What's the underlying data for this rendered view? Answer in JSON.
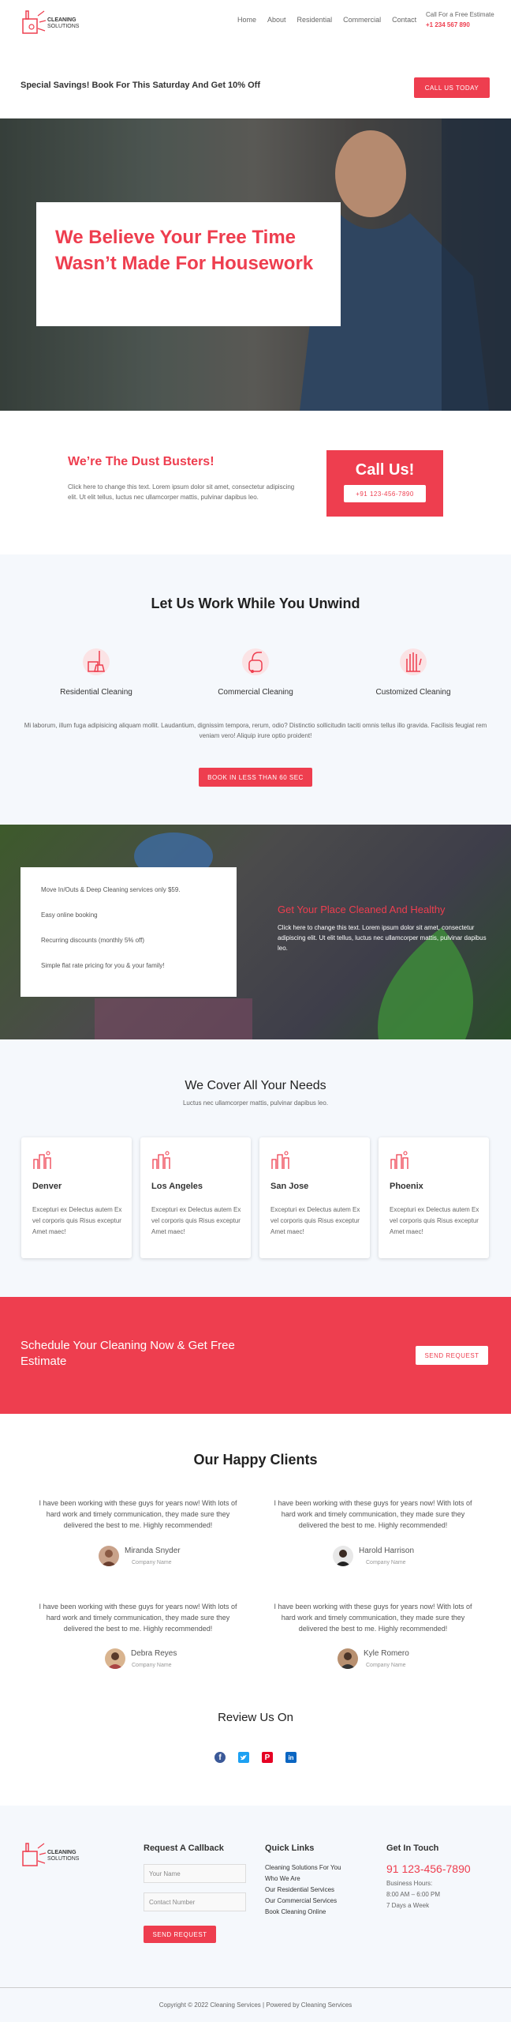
{
  "brand": {
    "line1": "CLEANING",
    "line2": "SOLUTIONS"
  },
  "nav": {
    "items": [
      "Home",
      "About",
      "Residential",
      "Commercial",
      "Contact"
    ],
    "call_label": "Call For a Free Estimate",
    "phone": "+1 234 567 890"
  },
  "promo": {
    "text": "Special Savings! Book For This Saturday And Get 10% Off",
    "button": "CALL US TODAY"
  },
  "hero": {
    "title": "We Believe Your Free Time Wasn’t Made For Housework"
  },
  "dust": {
    "title": "We’re The Dust Busters!",
    "text": "Click here to change this text. Lorem ipsum dolor sit amet, consectetur adipiscing elit. Ut elit tellus, luctus nec ullamcorper mattis, pulvinar dapibus leo.",
    "call_title": "Call Us!",
    "call_phone": "+91 123-456-7890"
  },
  "unwind": {
    "title": "Let Us Work While You Unwind",
    "services": [
      "Residential Cleaning",
      "Commercial Cleaning",
      "Customized Cleaning"
    ],
    "text": "Mi laborum, illum fuga adipisicing aliquam mollit. Laudantium, dignissim tempora, rerum, odio? Distinctio sollicitudin taciti omnis tellus illo gravida. Facilisis feugiat rem veniam vero! Aliquip irure optio proident!",
    "button": "BOOK IN LESS THAN 60 SEC"
  },
  "offers": {
    "items": [
      "Move In/Outs & Deep Cleaning services only $59.",
      "Easy online booking",
      "Recurring discounts (monthly 5% off)",
      "Simple flat rate pricing for you & your family!"
    ],
    "title": "Get Your Place Cleaned And Healthy",
    "text": "Click here to change this text. Lorem ipsum dolor sit amet, consectetur adipiscing elit. Ut elit tellus, luctus nec ullamcorper mattis, pulvinar dapibus leo."
  },
  "cover": {
    "title": "We Cover All Your Needs",
    "subtitle": "Luctus nec ullamcorper mattis, pulvinar dapibus leo.",
    "cities": [
      {
        "name": "Denver",
        "text": "Excepturi ex Delectus autem Ex vel corporis quis Risus exceptur Amet maec!"
      },
      {
        "name": "Los Angeles",
        "text": "Excepturi ex Delectus autem Ex vel corporis quis Risus exceptur Amet maec!"
      },
      {
        "name": "San Jose",
        "text": "Excepturi ex Delectus autem Ex vel corporis quis Risus exceptur Amet maec!"
      },
      {
        "name": "Phoenix",
        "text": "Excepturi ex Delectus autem Ex vel corporis quis Risus exceptur Amet maec!"
      }
    ]
  },
  "schedule": {
    "title": "Schedule Your Cleaning Now & Get Free Estimate",
    "button": "SEND REQUEST"
  },
  "clients": {
    "title": "Our Happy Clients",
    "testimonials": [
      {
        "quote": "I have been working with these guys for years now! With lots of hard work and timely communication, they made sure they delivered the best to me. Highly recommended!",
        "name": "Miranda Snyder",
        "company": "Company Name"
      },
      {
        "quote": "I have been working with these guys for years now! With lots of hard work and timely communication, they made sure they delivered the best to me. Highly recommended!",
        "name": "Harold Harrison",
        "company": "Company Name"
      },
      {
        "quote": "I have been working with these guys for years now! With lots of hard work and timely communication, they made sure they delivered the best to me. Highly recommended!",
        "name": "Debra Reyes",
        "company": "Company Name"
      },
      {
        "quote": "I have been working with these guys for years now! With lots of hard work and timely communication, they made sure they delivered the best to me. Highly recommended!",
        "name": "Kyle Romero",
        "company": "Company Name"
      }
    ]
  },
  "review": {
    "title": "Review Us On"
  },
  "footer": {
    "callback_title": "Request A Callback",
    "name_placeholder": "Your Name",
    "contact_placeholder": "Contact Number",
    "button": "SEND REQUEST",
    "links_title": "Quick Links",
    "links": [
      "Cleaning Solutions For You",
      "Who We Are",
      "Our Residential Services",
      "Our Commercial Services",
      "Book Cleaning Online"
    ],
    "touch_title": "Get In Touch",
    "phone": "91 123-456-7890",
    "hours_label": "Business Hours:",
    "hours": "8:00 AM – 6:00 PM",
    "days": "7 Days a Week",
    "copyright": "Copyright © 2022 Cleaning Services | Powered by Cleaning Services"
  },
  "colors": {
    "accent": "#ee3e4f",
    "light_bg": "#f5f8fc"
  }
}
